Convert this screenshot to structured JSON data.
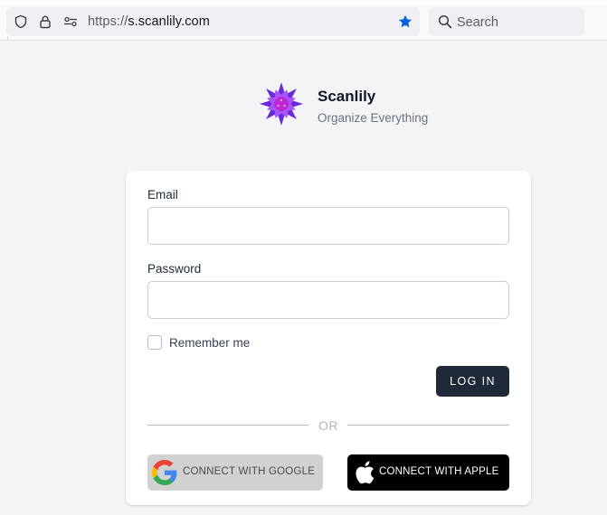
{
  "browser": {
    "url_scheme": "https://",
    "url_host": "s.scanlily.com",
    "search_placeholder": "Search",
    "icons": [
      "shield-icon",
      "lock-icon",
      "site-permissions-icon",
      "bookmark-star-icon",
      "search-icon"
    ],
    "bookmark_color": "#0060df"
  },
  "brand": {
    "name": "Scanlily",
    "tagline": "Organize Everything",
    "logo_colors": [
      "#6d28d9",
      "#9333ea",
      "#c026d3"
    ]
  },
  "form": {
    "email_label": "Email",
    "email_value": "",
    "password_label": "Password",
    "password_value": "",
    "remember_label": "Remember me",
    "remember_checked": false,
    "login_label": "LOG IN",
    "or_label": "OR",
    "google_label": "CONNECT WITH GOOGLE",
    "apple_label": "CONNECT WITH APPLE"
  },
  "colors": {
    "page_bg": "#f3f4f6",
    "primary_button": "#1f2937",
    "google_button": "#d1d1d1",
    "apple_button": "#000000"
  }
}
